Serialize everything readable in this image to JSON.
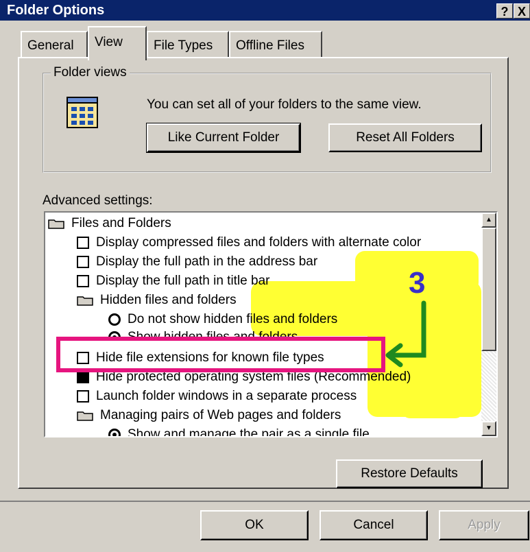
{
  "window": {
    "title": "Folder Options",
    "help_label": "?",
    "close_label": "X"
  },
  "tabs": [
    {
      "label": "General"
    },
    {
      "label": "View"
    },
    {
      "label": "File Types"
    },
    {
      "label": "Offline Files"
    }
  ],
  "folder_views": {
    "group_label": "Folder views",
    "description": "You can set all of your folders to the same view.",
    "like_current_label": "Like Current Folder",
    "reset_all_label": "Reset All Folders"
  },
  "advanced": {
    "label": "Advanced settings:",
    "items": [
      {
        "type": "folder",
        "label": "Files and Folders"
      },
      {
        "type": "checkbox",
        "checked": false,
        "label": "Display compressed files and folders with alternate color"
      },
      {
        "type": "checkbox",
        "checked": false,
        "label": "Display the full path in the address bar"
      },
      {
        "type": "checkbox",
        "checked": false,
        "label": "Display the full path in title bar"
      },
      {
        "type": "folder",
        "label": "Hidden files and folders"
      },
      {
        "type": "radio",
        "selected": false,
        "label": "Do not show hidden files and folders"
      },
      {
        "type": "radio",
        "selected": true,
        "label": "Show hidden files and folders"
      },
      {
        "type": "checkbox",
        "checked": false,
        "label": "Hide file extensions for known file types"
      },
      {
        "type": "checkbox",
        "checked": true,
        "label": "Hide protected operating system files (Recommended)"
      },
      {
        "type": "checkbox",
        "checked": false,
        "label": "Launch folder windows in a separate process"
      },
      {
        "type": "folder",
        "label": "Managing pairs of Web pages and folders"
      },
      {
        "type": "radio",
        "selected": true,
        "label": "Show and manage the pair as a single file"
      }
    ]
  },
  "annotation": {
    "number": "3",
    "box_color": "#e6157f",
    "arrow_color": "#1f8a1f",
    "highlight_color": "#ffff33"
  },
  "buttons": {
    "restore_defaults": "Restore Defaults",
    "ok": "OK",
    "cancel": "Cancel",
    "apply": "Apply"
  }
}
